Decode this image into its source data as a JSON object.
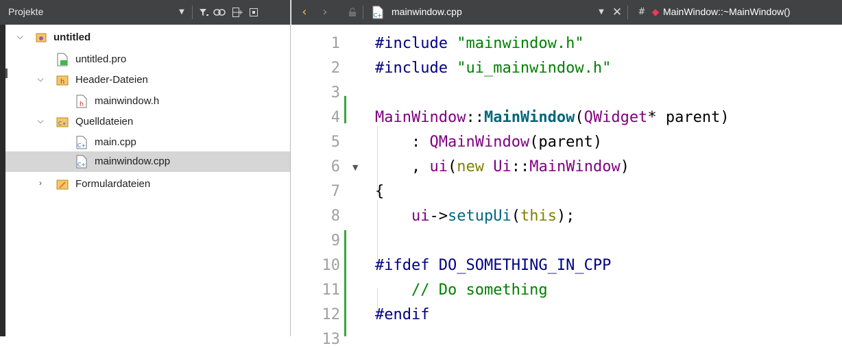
{
  "project_pane": {
    "title": "Projekte",
    "toolbar_icons": [
      "dropdown-icon",
      "filter-icon",
      "link-icon",
      "split-icon",
      "close-pane-icon"
    ],
    "tree": [
      {
        "label": "untitled",
        "icon": "project-icon",
        "expander": "expanded",
        "bold": true
      },
      {
        "label": "untitled.pro",
        "icon": "pro-file-icon"
      },
      {
        "label": "Header-Dateien",
        "icon": "header-folder-icon",
        "expander": "expanded"
      },
      {
        "label": "mainwindow.h",
        "icon": "header-file-icon"
      },
      {
        "label": "Quelldateien",
        "icon": "source-folder-icon",
        "expander": "expanded"
      },
      {
        "label": "main.cpp",
        "icon": "cpp-file-icon"
      },
      {
        "label": "mainwindow.cpp",
        "icon": "cpp-file-icon",
        "selected": true
      },
      {
        "label": "Formulardateien",
        "icon": "form-folder-icon",
        "expander": "collapsed"
      }
    ]
  },
  "editor": {
    "toolbar": {
      "file_name": "mainwindow.cpp",
      "hash": "#",
      "symbol": "MainWindow::~MainWindow()"
    },
    "line_numbers": [
      "1",
      "2",
      "3",
      "4",
      "5",
      "6",
      "7",
      "8",
      "9",
      "10",
      "11",
      "12"
    ],
    "changed_lines": [
      "4",
      "9",
      "10",
      "11",
      "12"
    ],
    "fold_marker_line": "6"
  },
  "colors": {
    "toolbar_bg": "#404244",
    "selection_bg": "#d6d6d6",
    "change_bar": "#3aa63a",
    "preprocessor": "#000080",
    "string": "#008000",
    "class": "#800080",
    "function": "#00677c"
  }
}
